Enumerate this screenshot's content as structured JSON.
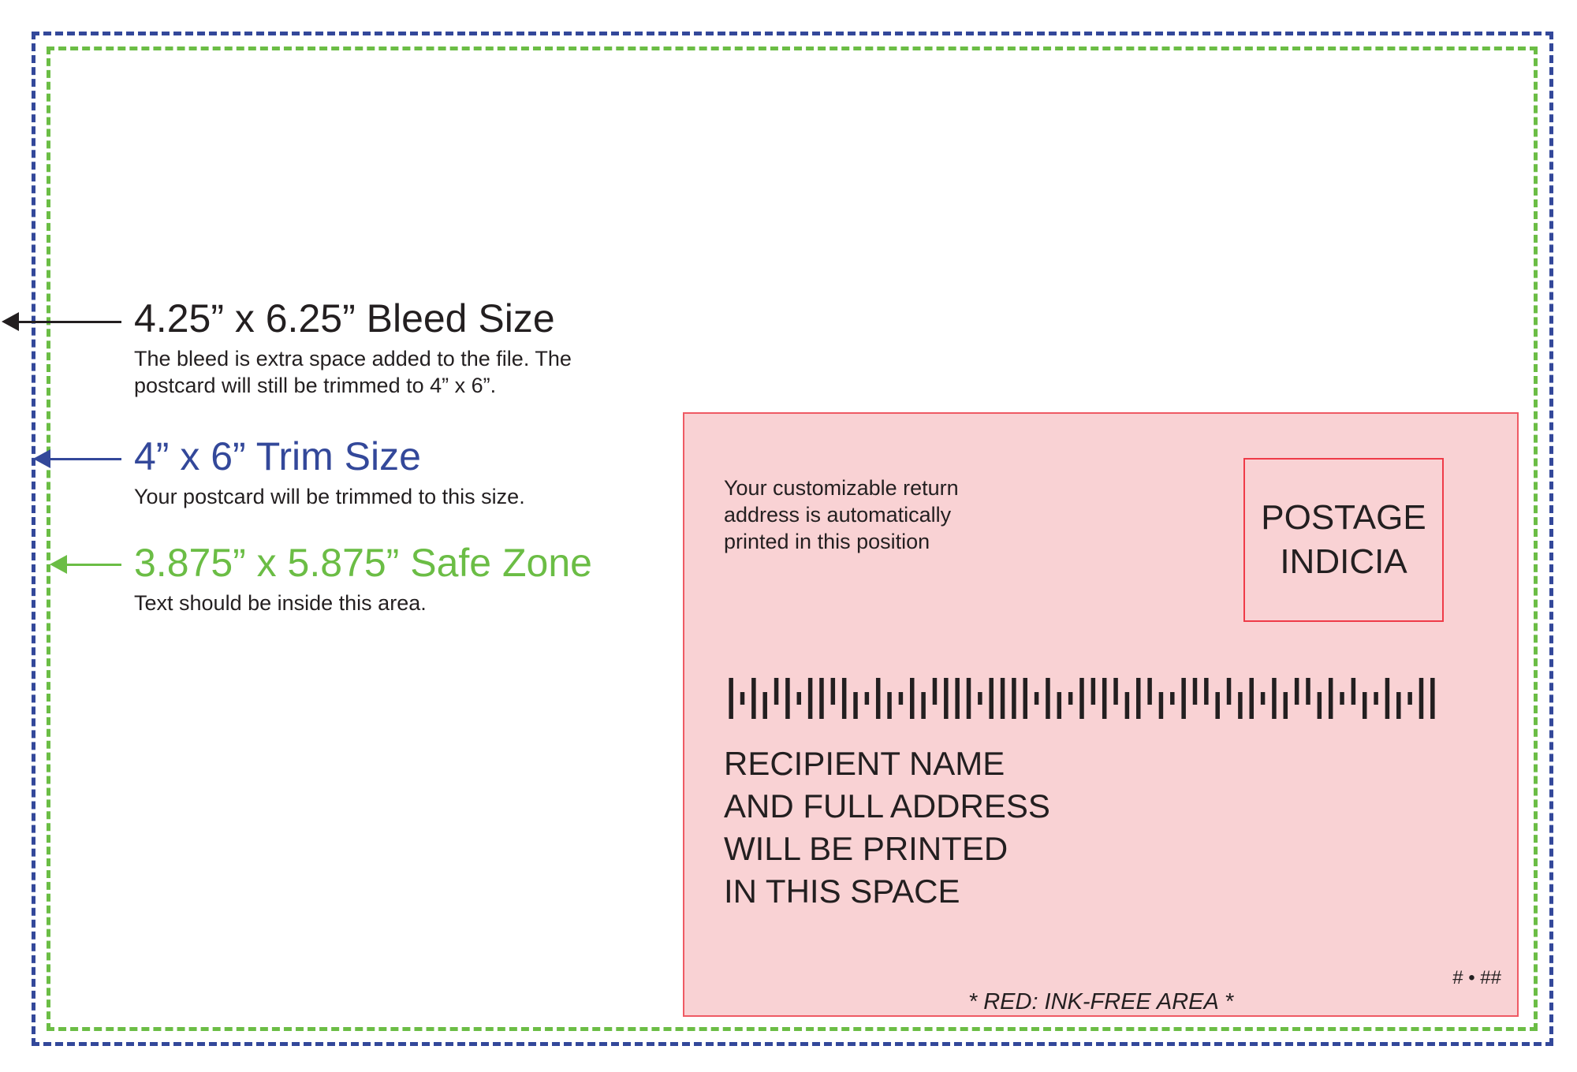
{
  "guides": {
    "bleed": {
      "title": "4.25” x 6.25” Bleed Size",
      "desc_line1": "The bleed is extra space added to the file. The",
      "desc_line2": "postcard will still be trimmed to 4” x 6”.",
      "color": "#231f20"
    },
    "trim": {
      "title": "4” x 6” Trim Size",
      "desc": "Your postcard will be trimmed to this size.",
      "color": "#33489a"
    },
    "safe": {
      "title": "3.875” x 5.875” Safe Zone",
      "desc": "Text should be inside this area.",
      "color": "#6bbd45"
    }
  },
  "ink_free_area": {
    "return_address_lines": [
      "Your customizable return",
      "address is automatically",
      "printed in this position"
    ],
    "indicia": [
      "POSTAGE",
      "INDICIA"
    ],
    "recipient_lines": [
      "RECIPIENT NAME",
      "AND FULL ADDRESS",
      "WILL BE PRINTED",
      "IN THIS SPACE"
    ],
    "ref_code": "# • ##",
    "note": "* RED: INK-FREE AREA *",
    "fill_color": "#f9d2d4",
    "border_color": "#ef5a64"
  },
  "barcode": {
    "pattern": "FTFDAFTFFAFDTFDTFDAFFFTFFFFTFDTFAFADFADTFAADADFTFDAADFTADTFDTFF"
  }
}
